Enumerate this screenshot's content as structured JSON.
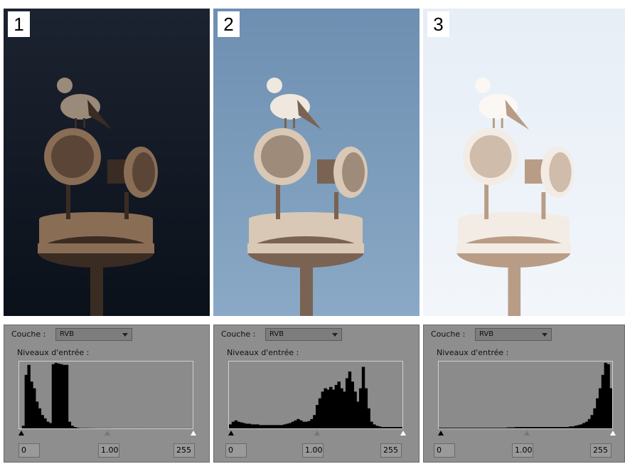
{
  "figures": [
    {
      "number": "1",
      "photo": {
        "sky_top": "#1c2330",
        "sky_bottom": "#0b111a",
        "metal": "#8a6d55",
        "metal_dark": "#3a2c22",
        "bird": "#9a8a7a"
      },
      "levels": {
        "couche_label": "Couche :",
        "couche_value": "RVB",
        "niveaux_label": "Niveaux d'entrée :",
        "black_point": "0",
        "gamma": "1.00",
        "white_point": "255",
        "histogram": [
          0,
          4,
          80,
          95,
          70,
          60,
          40,
          30,
          20,
          15,
          10,
          8,
          96,
          98,
          97,
          96,
          95,
          95,
          10,
          4,
          2,
          1,
          0.5,
          0.5,
          0.5,
          0.4,
          0.3,
          0.3,
          0.2,
          0.2,
          0.2,
          0.2,
          0.2,
          0.2,
          0.1,
          0.1,
          0.1,
          0.1,
          0.1,
          0.1,
          0.1,
          0.1,
          0.1,
          0.1,
          0.1,
          0.1,
          0.1,
          0.1,
          0.1,
          0.1,
          0.1,
          0.1,
          0.1,
          0.1,
          0.1,
          0.1,
          0.1,
          0.1,
          0.1,
          0.1,
          0.1,
          0.1,
          0.1,
          0.1
        ]
      }
    },
    {
      "number": "2",
      "photo": {
        "sky_top": "#6e8fb1",
        "sky_bottom": "#8aa9c6",
        "metal": "#d8c8b5",
        "metal_dark": "#7a6352",
        "bird": "#efe8df"
      },
      "levels": {
        "couche_label": "Couche :",
        "couche_value": "RVB",
        "niveaux_label": "Niveaux d'entrée :",
        "black_point": "0",
        "gamma": "1.00",
        "white_point": "255",
        "histogram": [
          6,
          10,
          12,
          10,
          9,
          8,
          7,
          7,
          6,
          6,
          6,
          5,
          5,
          5,
          5,
          5,
          5,
          5,
          5,
          5,
          6,
          7,
          8,
          10,
          12,
          14,
          12,
          10,
          10,
          11,
          14,
          20,
          35,
          45,
          55,
          60,
          58,
          62,
          58,
          65,
          70,
          60,
          55,
          75,
          85,
          70,
          55,
          40,
          60,
          92,
          60,
          30,
          10,
          6,
          4,
          3,
          2,
          2,
          2,
          2,
          2,
          2,
          2,
          2
        ]
      }
    },
    {
      "number": "3",
      "photo": {
        "sky_top": "#e7eef6",
        "sky_bottom": "#f2f6fb",
        "metal": "#f3ece4",
        "metal_dark": "#b89c86",
        "bird": "#fbf8f4"
      },
      "levels": {
        "couche_label": "Couche :",
        "couche_value": "RVB",
        "niveaux_label": "Niveaux d'entrée :",
        "black_point": "0",
        "gamma": "1.00",
        "white_point": "255",
        "histogram": [
          1,
          1,
          1,
          1,
          1,
          1,
          1,
          1,
          1,
          1,
          1,
          1,
          1,
          1,
          1,
          1,
          1,
          1,
          1,
          1,
          1,
          1,
          1,
          1,
          1,
          1.5,
          1.5,
          1.5,
          2,
          2,
          2,
          2,
          2,
          2,
          2,
          2,
          2,
          2,
          2,
          2,
          2,
          2,
          2,
          2,
          2,
          2,
          2,
          2,
          3,
          3,
          4,
          5,
          6,
          8,
          10,
          14,
          20,
          30,
          45,
          60,
          80,
          98,
          96,
          60
        ]
      }
    }
  ]
}
